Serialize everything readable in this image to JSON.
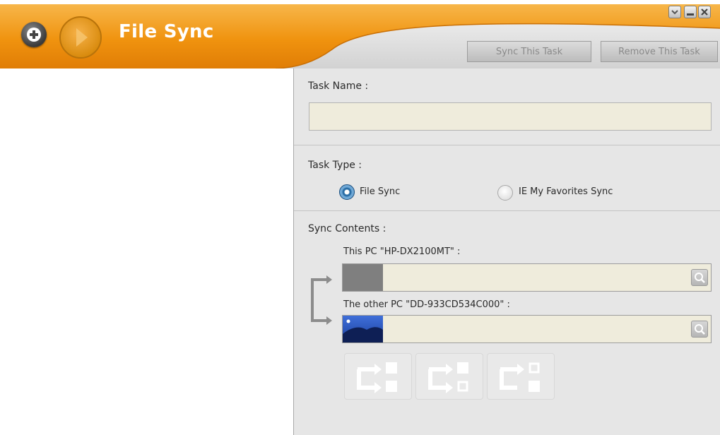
{
  "header": {
    "title": "File Sync",
    "accent_color": "#f0930f",
    "icons": {
      "add": "plus-icon",
      "play": "play-icon",
      "minimize_options": "chevron-down-icon",
      "minimize": "minimize-icon",
      "close": "close-icon"
    },
    "buttons": {
      "sync_task": "Sync This Task",
      "remove_task": "Remove This Task"
    }
  },
  "form": {
    "task_name": {
      "label": "Task Name :",
      "value": ""
    },
    "task_type": {
      "label": "Task Type :",
      "options": [
        {
          "label": "File Sync",
          "selected": true
        },
        {
          "label": "IE My Favorites Sync",
          "selected": false
        }
      ]
    },
    "sync_contents": {
      "label": "Sync Contents :",
      "this_pc": {
        "label": "This PC \"HP-DX2100MT\" :",
        "value": ""
      },
      "other_pc": {
        "label": "The other PC \"DD-933CD534C000\" :",
        "value": ""
      },
      "icons": {
        "link": "sync-link-arrow-icon",
        "browse": "search-icon",
        "modes": [
          "two-way-sync-icon",
          "one-way-sync-icon",
          "backup-sync-icon"
        ]
      }
    }
  }
}
